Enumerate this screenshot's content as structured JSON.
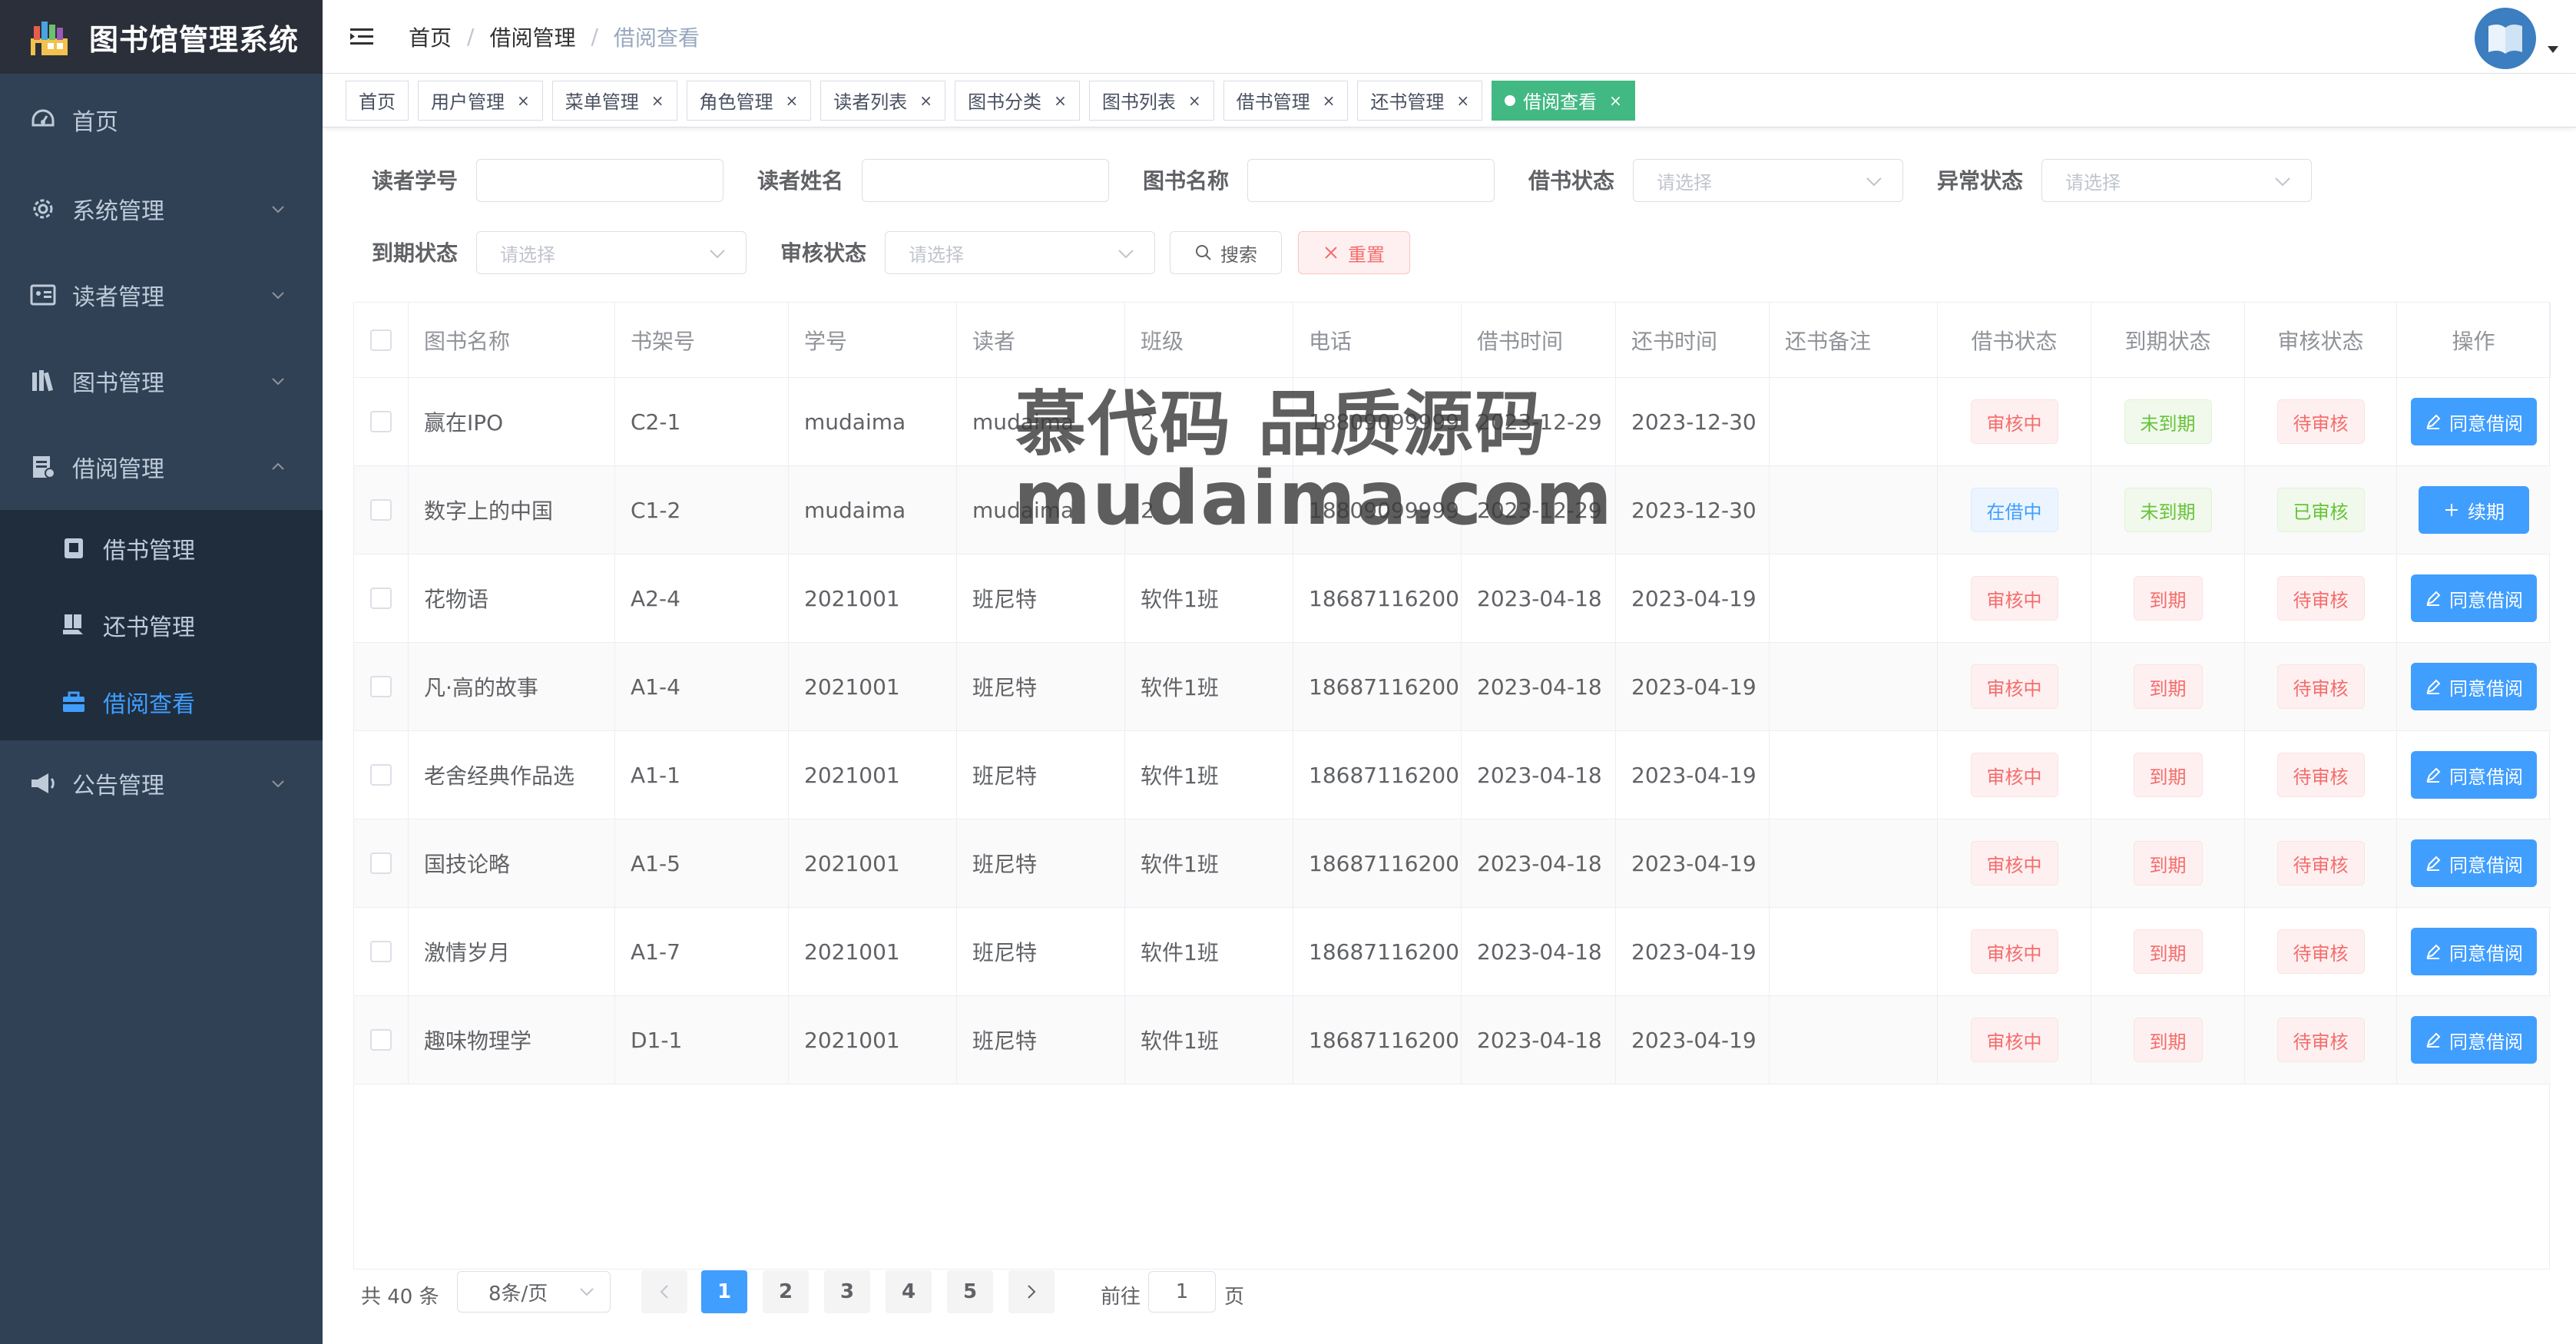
{
  "brand": {
    "title": "图书馆管理系统",
    "logo_icon": "library-logo-icon"
  },
  "sidebar": {
    "items": [
      {
        "label": "首页",
        "icon": "dashboard-icon"
      },
      {
        "label": "系统管理",
        "icon": "gear-icon"
      },
      {
        "label": "读者管理",
        "icon": "id-card-icon"
      },
      {
        "label": "图书管理",
        "icon": "books-icon"
      },
      {
        "label": "借阅管理",
        "icon": "document-icon"
      },
      {
        "label": "公告管理",
        "icon": "megaphone-icon"
      }
    ],
    "sub_items": [
      {
        "label": "借书管理",
        "icon": "book-icon"
      },
      {
        "label": "还书管理",
        "icon": "return-book-icon"
      },
      {
        "label": "借阅查看",
        "icon": "briefcase-icon"
      }
    ]
  },
  "header": {
    "breadcrumb": [
      "首页",
      "借阅管理",
      "借阅查看"
    ],
    "separator": "/"
  },
  "tags": [
    "首页",
    "用户管理",
    "菜单管理",
    "角色管理",
    "读者列表",
    "图书分类",
    "图书列表",
    "借书管理",
    "还书管理",
    "借阅查看"
  ],
  "tag_close": "×",
  "filters": {
    "student_id_label": "读者学号",
    "reader_name_label": "读者姓名",
    "book_name_label": "图书名称",
    "borrow_status_label": "借书状态",
    "abnormal_status_label": "异常状态",
    "due_status_label": "到期状态",
    "audit_status_label": "审核状态",
    "select_placeholder": "请选择",
    "search_label": "搜索",
    "reset_label": "重置"
  },
  "table": {
    "headers": [
      "图书名称",
      "书架号",
      "学号",
      "读者",
      "班级",
      "电话",
      "借书时间",
      "还书时间",
      "还书备注",
      "借书状态",
      "到期状态",
      "审核状态",
      "操作"
    ],
    "rows": [
      {
        "book": "赢在IPO",
        "shelf": "C2-1",
        "sid": "mudaima",
        "reader": "mudaima",
        "cls": "2",
        "phone": "18809099999",
        "borrow": "2023-12-29",
        "ret": "2023-12-30",
        "note": "",
        "bs": "审核中",
        "ds": "未到期",
        "as": "待审核",
        "action": "同意借阅"
      },
      {
        "book": "数字上的中国",
        "shelf": "C1-2",
        "sid": "mudaima",
        "reader": "mudaima",
        "cls": "2",
        "phone": "18809099999",
        "borrow": "2023-12-29",
        "ret": "2023-12-30",
        "note": "",
        "bs": "在借中",
        "ds": "未到期",
        "as": "已审核",
        "action": "续期"
      },
      {
        "book": "花物语",
        "shelf": "A2-4",
        "sid": "2021001",
        "reader": "班尼特",
        "cls": "软件1班",
        "phone": "18687116200",
        "borrow": "2023-04-18",
        "ret": "2023-04-19",
        "note": "",
        "bs": "审核中",
        "ds": "到期",
        "as": "待审核",
        "action": "同意借阅"
      },
      {
        "book": "凡·高的故事",
        "shelf": "A1-4",
        "sid": "2021001",
        "reader": "班尼特",
        "cls": "软件1班",
        "phone": "18687116200",
        "borrow": "2023-04-18",
        "ret": "2023-04-19",
        "note": "",
        "bs": "审核中",
        "ds": "到期",
        "as": "待审核",
        "action": "同意借阅"
      },
      {
        "book": "老舍经典作品选",
        "shelf": "A1-1",
        "sid": "2021001",
        "reader": "班尼特",
        "cls": "软件1班",
        "phone": "18687116200",
        "borrow": "2023-04-18",
        "ret": "2023-04-19",
        "note": "",
        "bs": "审核中",
        "ds": "到期",
        "as": "待审核",
        "action": "同意借阅"
      },
      {
        "book": "国技论略",
        "shelf": "A1-5",
        "sid": "2021001",
        "reader": "班尼特",
        "cls": "软件1班",
        "phone": "18687116200",
        "borrow": "2023-04-18",
        "ret": "2023-04-19",
        "note": "",
        "bs": "审核中",
        "ds": "到期",
        "as": "待审核",
        "action": "同意借阅"
      },
      {
        "book": "激情岁月",
        "shelf": "A1-7",
        "sid": "2021001",
        "reader": "班尼特",
        "cls": "软件1班",
        "phone": "18687116200",
        "borrow": "2023-04-18",
        "ret": "2023-04-19",
        "note": "",
        "bs": "审核中",
        "ds": "到期",
        "as": "待审核",
        "action": "同意借阅"
      },
      {
        "book": "趣味物理学",
        "shelf": "D1-1",
        "sid": "2021001",
        "reader": "班尼特",
        "cls": "软件1班",
        "phone": "18687116200",
        "borrow": "2023-04-18",
        "ret": "2023-04-19",
        "note": "",
        "bs": "审核中",
        "ds": "到期",
        "as": "待审核",
        "action": "同意借阅"
      }
    ]
  },
  "pagination": {
    "total": "共 40 条",
    "page_size": "8条/页",
    "pages": [
      "1",
      "2",
      "3",
      "4",
      "5"
    ],
    "current": "1",
    "goto_prefix": "前往",
    "goto_value": "1",
    "goto_suffix": "页"
  },
  "watermark": {
    "line1": "慕代码 品质源码",
    "line2": "mudaima.com"
  },
  "colors": {
    "sidebar_bg": "#304156",
    "active": "#409eff",
    "tag_active": "#42b983",
    "danger": "#f56c6c",
    "success": "#67c23a"
  }
}
